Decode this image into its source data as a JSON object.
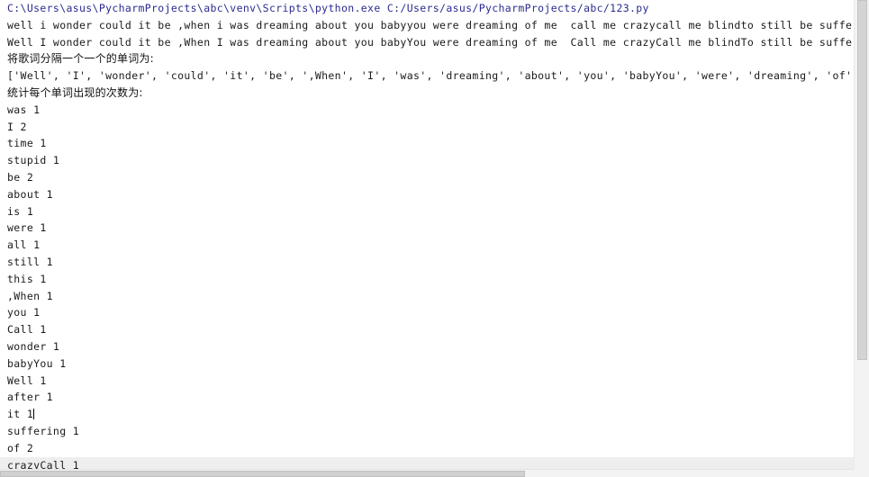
{
  "console": {
    "command_line": "C:\\Users\\asus\\PycharmProjects\\abc\\venv\\Scripts\\python.exe C:/Users/asus/PycharmProjects/abc/123.py",
    "raw_lyrics_line": "well i wonder could it be ,when i was dreaming about you babyyou were dreaming of me  call me crazycall me blindto still be suffering is stupid after all of th",
    "capitalized_lyrics_line": "Well I wonder could it be ,When I was dreaming about you babyYou were dreaming of me  Call me crazyCall me blindTo still be suffering is stupid after all of th",
    "split_header_cjk": "将歌词分隔一个一个的单词为:",
    "split_list_line": "['Well', 'I', 'wonder', 'could', 'it', 'be', ',When', 'I', 'was', 'dreaming', 'about', 'you', 'babyYou', 'were', 'dreaming', 'of', 'me', 'Call', 'me', 'crazyCa",
    "count_header_cjk": "统计每个单词出现的次数为:",
    "word_counts": [
      {
        "word": "was",
        "count": "1",
        "text": "was 1"
      },
      {
        "word": "I",
        "count": "2",
        "text": "I 2"
      },
      {
        "word": "time",
        "count": "1",
        "text": "time 1"
      },
      {
        "word": "stupid",
        "count": "1",
        "text": "stupid 1"
      },
      {
        "word": "be",
        "count": "2",
        "text": "be 2"
      },
      {
        "word": "about",
        "count": "1",
        "text": "about 1"
      },
      {
        "word": "is",
        "count": "1",
        "text": "is 1"
      },
      {
        "word": "were",
        "count": "1",
        "text": "were 1"
      },
      {
        "word": "all",
        "count": "1",
        "text": "all 1"
      },
      {
        "word": "still",
        "count": "1",
        "text": "still 1"
      },
      {
        "word": "this",
        "count": "1",
        "text": "this 1"
      },
      {
        "word": ",When",
        "count": "1",
        "text": ",When 1"
      },
      {
        "word": "you",
        "count": "1",
        "text": "you 1"
      },
      {
        "word": "Call",
        "count": "1",
        "text": "Call 1"
      },
      {
        "word": "wonder",
        "count": "1",
        "text": "wonder 1"
      },
      {
        "word": "babyYou",
        "count": "1",
        "text": "babyYou 1"
      },
      {
        "word": "Well",
        "count": "1",
        "text": "Well 1"
      },
      {
        "word": "after",
        "count": "1",
        "text": "after 1"
      },
      {
        "word": "it",
        "count": "1",
        "text": "it 1"
      },
      {
        "word": "suffering",
        "count": "1",
        "text": "suffering 1"
      },
      {
        "word": "of",
        "count": "2",
        "text": "of 2"
      },
      {
        "word": "crazyCall",
        "count": "1",
        "text": "crazyCall 1"
      }
    ]
  },
  "colors": {
    "background": "#ffffff",
    "text": "#1a1a1a",
    "command_line_text": "#2b2b8f",
    "highlight_row": "#eeeeee",
    "scrollbar_track": "#f3f3f3",
    "scrollbar_thumb": "#d4d4d4"
  }
}
